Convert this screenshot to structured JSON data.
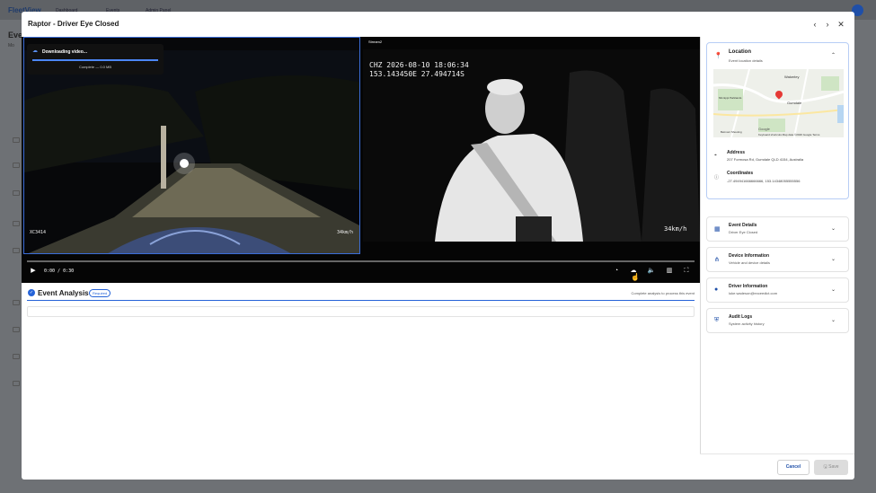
{
  "background": {
    "brand": "FleetView",
    "nav": [
      "Dashboard",
      "Events",
      "Admin Panel"
    ],
    "page_title": "Eve",
    "page_sub": "Mo"
  },
  "modal": {
    "title": "Raptor - Driver Eye Closed",
    "prev_icon": "chevron-left-icon",
    "next_icon": "chevron-right-icon",
    "close_icon": "close-icon"
  },
  "player": {
    "stream2_label": "Stream2",
    "download": {
      "title": "Downloading video...",
      "status": "Complete — 0.0 MB",
      "progress": 1.0
    },
    "stream1_left_osd": "XC3414",
    "stream1_right_osd": "34km/h",
    "stream2_osd_line1": "CHZ  2026-08-10 18:06:34",
    "stream2_osd_line2": "153.143450E 27.494714S",
    "stream2_speed": "34km/h",
    "time": "0:00 / 0:30",
    "playback_progress": 0.0
  },
  "analysis": {
    "title": "Event Analysis",
    "badge": "Required",
    "hint": "Complete analysis to process this event"
  },
  "location": {
    "title": "Location",
    "subtitle": "Event location details",
    "map_labels": [
      "Wakerley",
      "Gumdale",
      "Minnippi Parklands",
      "Belmont Shooting"
    ],
    "map_footer": "Keyboard shortcuts   Map data ©2026 Google   Terms",
    "google": "Google",
    "address_label": "Address",
    "address_value": "207 Formosa Rd, Gumdale QLD 4154, Australia",
    "coords_label": "Coordinates",
    "coords_value": "-27.494941666666666, 153.14348055555556"
  },
  "sections": [
    {
      "title": "Event Details",
      "subtitle": "Driver Eye Closed",
      "icon": "calendar-icon"
    },
    {
      "title": "Device Information",
      "subtitle": "Vehicle and device details",
      "icon": "network-icon"
    },
    {
      "title": "Driver Information",
      "subtitle": "luke.wadeson@exceedict.com",
      "icon": "person-icon"
    },
    {
      "title": "Audit Logs",
      "subtitle": "System activity history",
      "icon": "shield-icon"
    }
  ],
  "footer": {
    "cancel": "Cancel",
    "save": "Save"
  },
  "colors": {
    "accent": "#2563d8",
    "overlay": "#6e7175"
  }
}
